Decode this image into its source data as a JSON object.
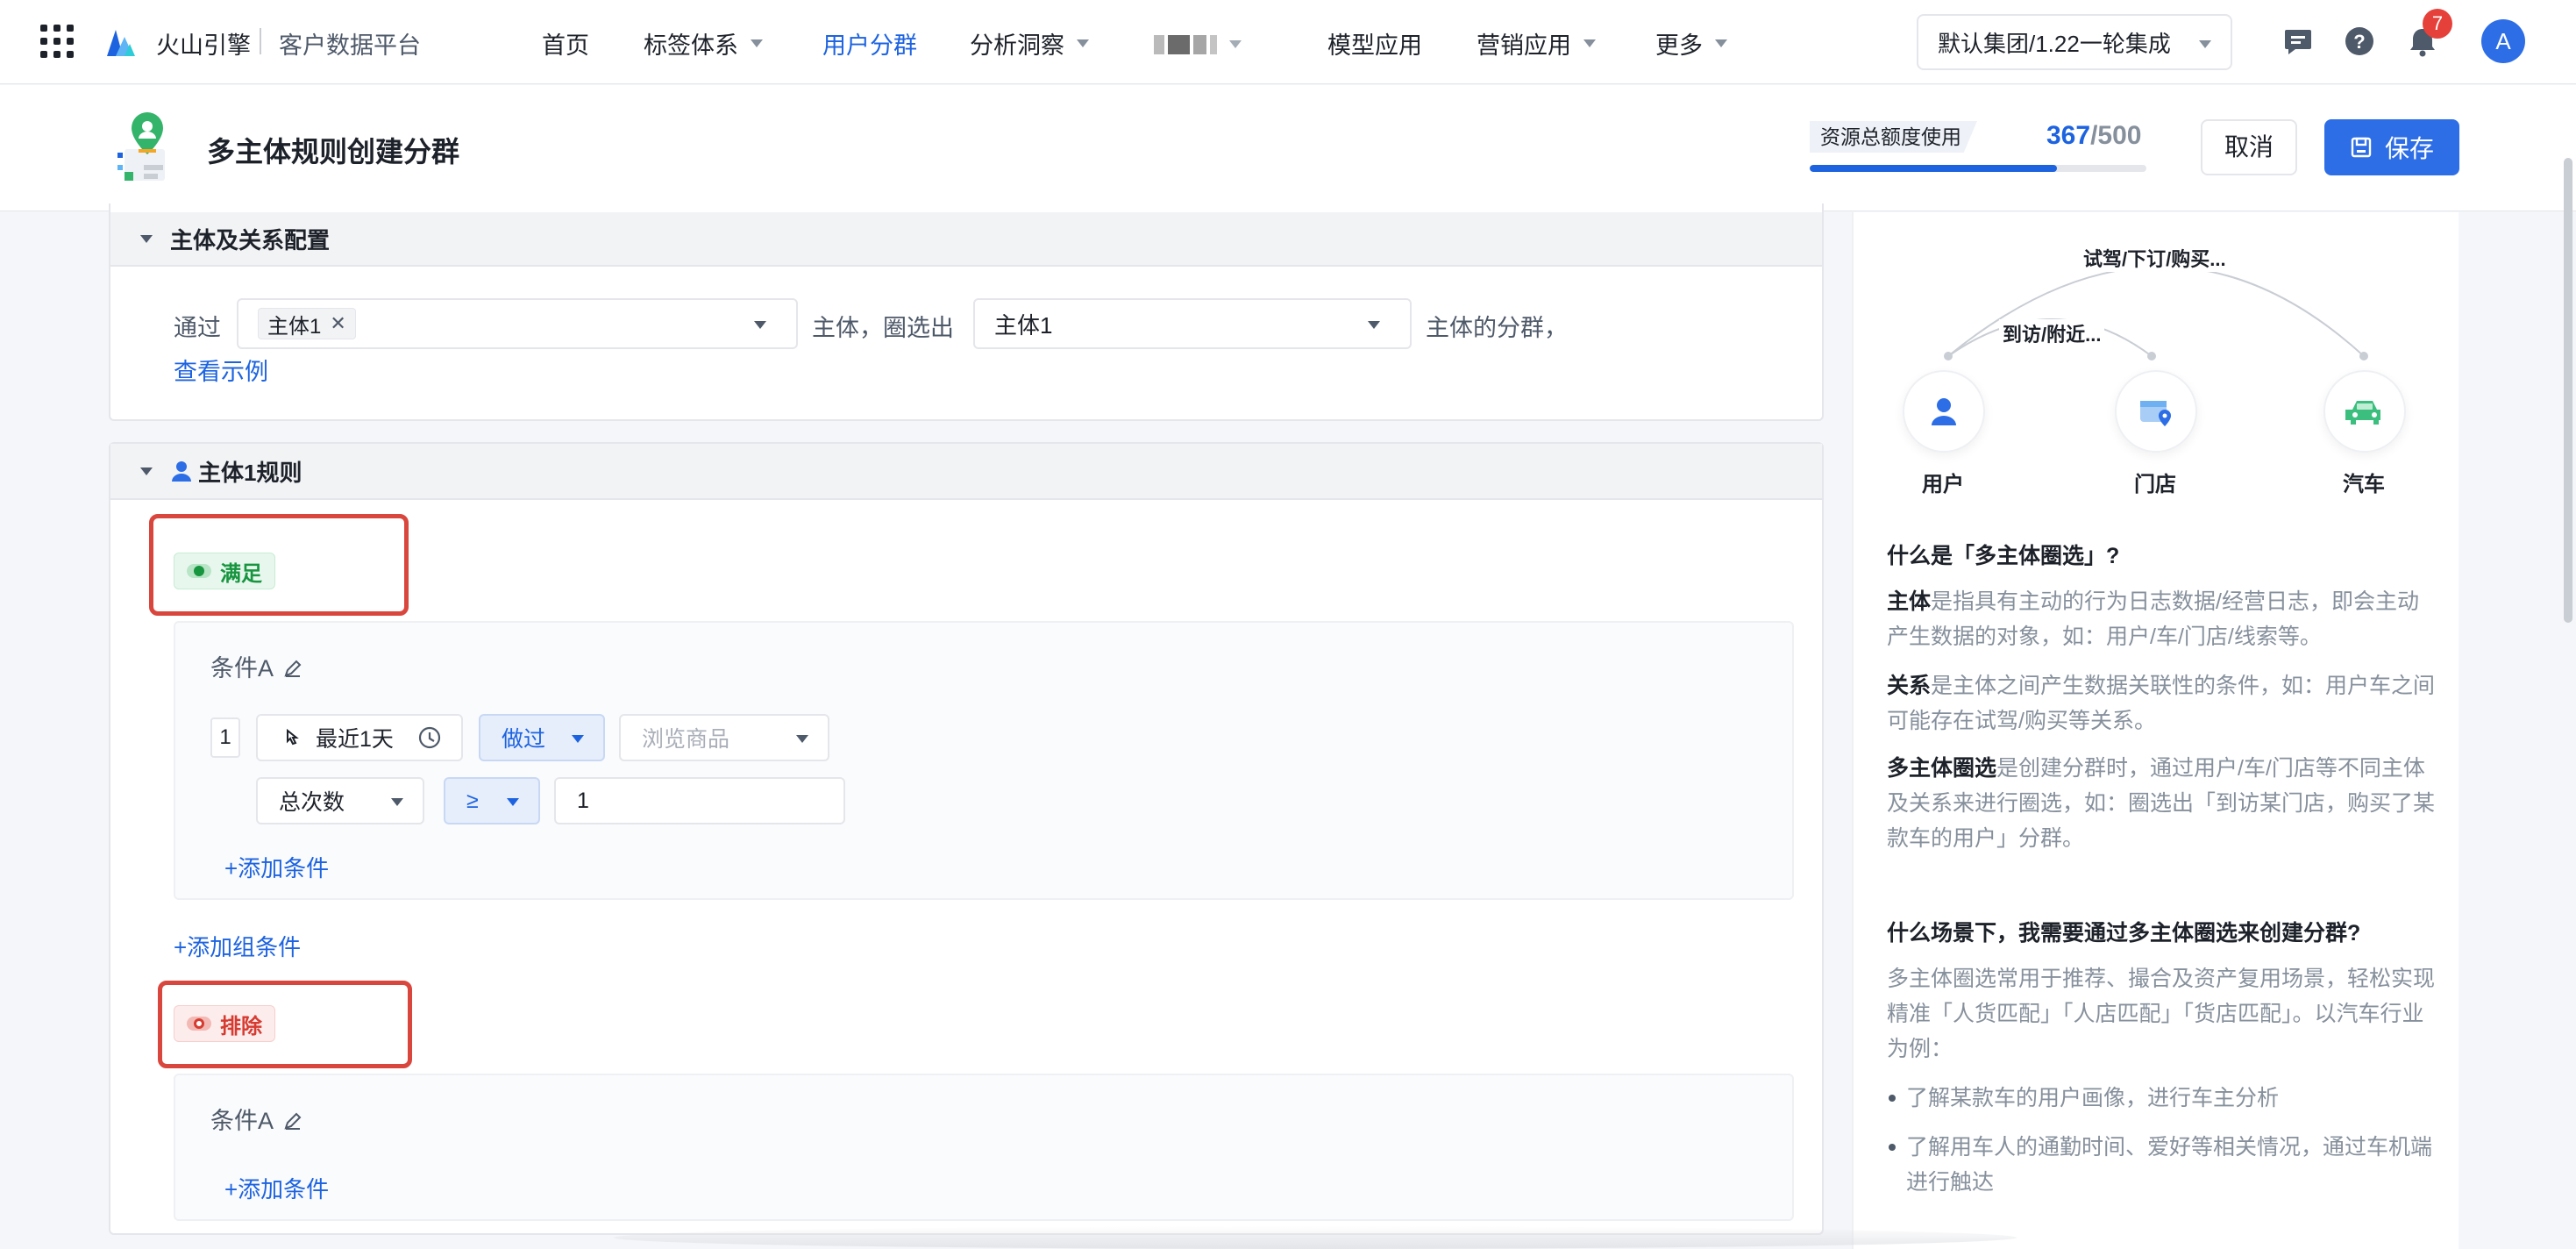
{
  "nav": {
    "brand": "火山引擎",
    "product": "客户数据平台",
    "items": [
      {
        "label": "首页",
        "active": false,
        "dropdown": false
      },
      {
        "label": "标签体系",
        "active": false,
        "dropdown": true
      },
      {
        "label": "用户分群",
        "active": true,
        "dropdown": false
      },
      {
        "label": "分析洞察",
        "active": false,
        "dropdown": true
      },
      {
        "label": "模型应用",
        "active": false,
        "dropdown": false
      },
      {
        "label": "营销应用",
        "active": false,
        "dropdown": true
      },
      {
        "label": "更多",
        "active": false,
        "dropdown": true
      }
    ],
    "tenant": "默认集团/1.22一轮集成",
    "notification_count": "7",
    "avatar_initial": "A"
  },
  "header": {
    "title": "多主体规则创建分群",
    "quota_label": "资源总额度使用",
    "quota_used": "367",
    "quota_total": "/500",
    "quota_fraction": 0.734,
    "cancel_label": "取消",
    "save_label": "保存"
  },
  "entity_config": {
    "section_title": "主体及关系配置",
    "via_label": "通过",
    "selected_tag": "主体1",
    "mid_label": "主体，圈选出",
    "target_value": "主体1",
    "suffix_label": "主体的分群，",
    "example_link": "查看示例"
  },
  "rules": {
    "section_title": "主体1规则",
    "include_badge": "满足",
    "include_condition": {
      "name": "条件A",
      "row_index": "1",
      "time_range": "最近1天",
      "action": "做过",
      "event_placeholder": "浏览商品",
      "metric": "总次数",
      "operator": "≥",
      "value": "1",
      "add_condition": "+添加条件"
    },
    "add_group": "+添加组条件",
    "exclude_badge": "排除",
    "exclude_condition": {
      "name": "条件A",
      "add_condition": "+添加条件"
    }
  },
  "side_panel": {
    "arc_outer_label": "试驾/下订/购买...",
    "arc_inner_label": "到访/附近...",
    "entities": [
      "用户",
      "门店",
      "汽车"
    ],
    "q1_title": "什么是「多主体圈选」?",
    "p1_bold": "主体",
    "p1_text": "是指具有主动的行为日志数据/经营日志，即会主动产生数据的对象，如：用户/车/门店/线索等。",
    "p2_bold": "关系",
    "p2_text": "是主体之间产生数据关联性的条件，如：用户车之间可能存在试驾/购买等关系。",
    "p3_bold": "多主体圈选",
    "p3_text": "是创建分群时，通过用户/车/门店等不同主体及关系来进行圈选，如：圈选出「到访某门店，购买了某款车的用户」分群。",
    "q2_title": "什么场景下，我需要通过多主体圈选来创建分群?",
    "p4_text": "多主体圈选常用于推荐、撮合及资产复用场景，轻松实现精准「人货匹配」「人店匹配」「货店匹配」。以汽车行业为例：",
    "bullets": [
      "了解某款车的用户画像，进行车主分析",
      "了解用车人的通勤时间、爱好等相关情况，通过车机端进行触达"
    ]
  },
  "colors": {
    "accent": "#2d6ee6",
    "include_green": "#17953f",
    "exclude_red": "#d63b31",
    "highlight_red": "#d9463d"
  }
}
